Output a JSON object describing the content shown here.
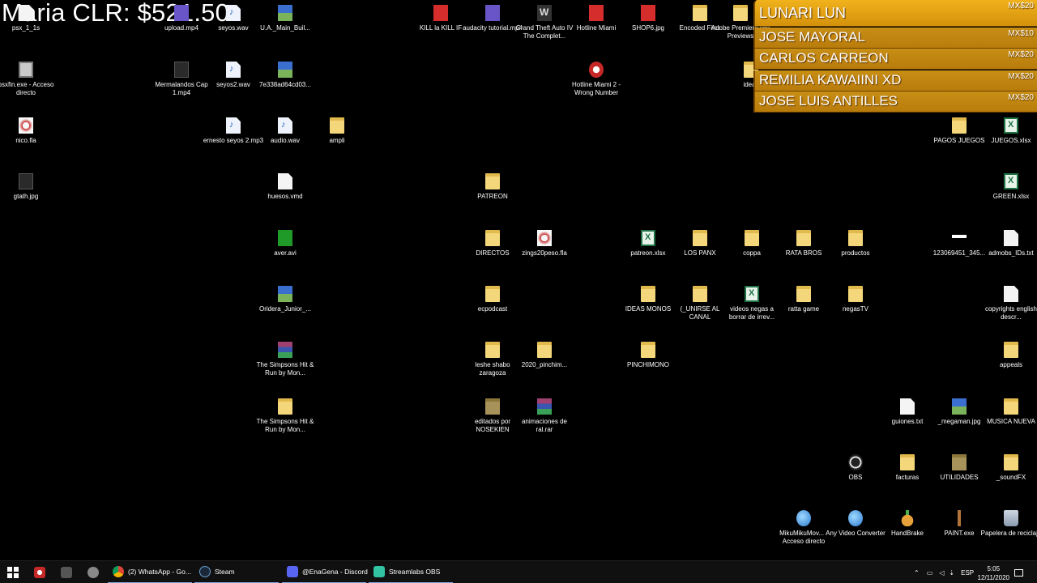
{
  "overlay": {
    "title": "Maria CLR: $521.50"
  },
  "leaderboard": [
    {
      "name": "LUNARI LUN",
      "amount": "MX$20"
    },
    {
      "name": "JOSE MAYORAL",
      "amount": "MX$10"
    },
    {
      "name": "CARLOS CARREON",
      "amount": "MX$20"
    },
    {
      "name": "REMILIA KAWAIINI XD",
      "amount": "MX$20"
    },
    {
      "name": "JOSE LUIS ANTILLES",
      "amount": "MX$20"
    }
  ],
  "desktop": {
    "icons": [
      {
        "label": "psx_1_1s",
        "icon": "file-icon"
      },
      {
        "label": "upload.mp4",
        "icon": "video-file-icon"
      },
      {
        "label": "seyos.wav",
        "icon": "audio-file-icon"
      },
      {
        "label": "U.A._Main_Buil...",
        "icon": "image-file-icon"
      },
      {
        "label": "KILL la KILL IF",
        "icon": "game-icon"
      },
      {
        "label": "audacity tutorial.mp4",
        "icon": "video-file-icon"
      },
      {
        "label": "Grand Theft Auto IV The Complet...",
        "icon": "game-icon"
      },
      {
        "label": "Hotline Miami",
        "icon": "game-icon"
      },
      {
        "label": "SHOP6.jpg",
        "icon": "image-file-icon"
      },
      {
        "label": "Encoded Files",
        "icon": "folder-icon"
      },
      {
        "label": "Adobe Premiere Pro Previews",
        "icon": "folder-icon"
      },
      {
        "label": "psxfin.exe - Acceso directo",
        "icon": "shortcut-icon"
      },
      {
        "label": "Mermalandos Cap 1.mp4",
        "icon": "video-file-icon"
      },
      {
        "label": "seyos2.wav",
        "icon": "audio-file-icon"
      },
      {
        "label": "7e338ad64cd03...",
        "icon": "image-file-icon"
      },
      {
        "label": "Hotline Miami 2 - Wrong Number",
        "icon": "game-icon"
      },
      {
        "label": "ideas",
        "icon": "folder-icon"
      },
      {
        "label": "nico.fla",
        "icon": "fla-file-icon"
      },
      {
        "label": "ernesto seyos 2.mp3",
        "icon": "audio-file-icon"
      },
      {
        "label": "audio.wav",
        "icon": "audio-file-icon"
      },
      {
        "label": "ampli",
        "icon": "folder-icon"
      },
      {
        "label": "PAGOS JUEGOS",
        "icon": "folder-icon"
      },
      {
        "label": "JUEGOS.xlsx",
        "icon": "excel-file-icon"
      },
      {
        "label": "gtath.jpg",
        "icon": "image-file-icon"
      },
      {
        "label": "huesos.vmd",
        "icon": "file-icon"
      },
      {
        "label": "PATREON",
        "icon": "folder-icon"
      },
      {
        "label": "GREEN.xlsx",
        "icon": "excel-file-icon"
      },
      {
        "label": "aver.avi",
        "icon": "video-file-icon"
      },
      {
        "label": "DIRECTOS",
        "icon": "folder-icon"
      },
      {
        "label": "zings20peso.fla",
        "icon": "fla-file-icon"
      },
      {
        "label": "patreon.xlsx",
        "icon": "excel-file-icon"
      },
      {
        "label": "LOS PANX",
        "icon": "folder-icon"
      },
      {
        "label": "coppa",
        "icon": "folder-icon"
      },
      {
        "label": "RATA BROS",
        "icon": "folder-icon"
      },
      {
        "label": "productos",
        "icon": "folder-icon"
      },
      {
        "label": "123069451_345...",
        "icon": "image-file-icon"
      },
      {
        "label": "admobs_IDs.txt",
        "icon": "text-file-icon"
      },
      {
        "label": "Oridera_Junior_...",
        "icon": "image-file-icon"
      },
      {
        "label": "ecpodcast",
        "icon": "folder-icon"
      },
      {
        "label": "IDEAS MONOS",
        "icon": "folder-icon"
      },
      {
        "label": "(_UNIRSE AL CANAL",
        "icon": "folder-icon"
      },
      {
        "label": "videos negas a borrar de irrev...",
        "icon": "excel-file-icon"
      },
      {
        "label": "ratta game",
        "icon": "folder-icon"
      },
      {
        "label": "negasTV",
        "icon": "folder-icon"
      },
      {
        "label": "copyrights english descr...",
        "icon": "text-file-icon"
      },
      {
        "label": "The Simpsons Hit & Run by Mon...",
        "icon": "archive-icon"
      },
      {
        "label": "leshe shabo zaragoza",
        "icon": "folder-icon"
      },
      {
        "label": "2020_pinchim...",
        "icon": "folder-icon"
      },
      {
        "label": "PINCHIMONO",
        "icon": "folder-icon"
      },
      {
        "label": "appeals",
        "icon": "folder-icon"
      },
      {
        "label": "The Simpsons Hit & Run by Mon...",
        "icon": "folder-icon"
      },
      {
        "label": "editados por NOSEKIEN",
        "icon": "folder-icon"
      },
      {
        "label": "animaciones de ral.rar",
        "icon": "archive-icon"
      },
      {
        "label": "guiones.txt",
        "icon": "text-file-icon"
      },
      {
        "label": "_megaman.jpg",
        "icon": "image-file-icon"
      },
      {
        "label": "MUSICA NUEVA",
        "icon": "folder-icon"
      },
      {
        "label": "OBS",
        "icon": "obs-icon"
      },
      {
        "label": "facturas",
        "icon": "folder-icon"
      },
      {
        "label": "UTILIDADES",
        "icon": "folder-icon"
      },
      {
        "label": "_soundFX",
        "icon": "folder-icon"
      },
      {
        "label": "MikuMikuMov... - Acceso directo",
        "icon": "shortcut-icon"
      },
      {
        "label": "Any Video Converter",
        "icon": "app-icon"
      },
      {
        "label": "HandBrake",
        "icon": "app-icon"
      },
      {
        "label": "PAINT.exe",
        "icon": "app-icon"
      },
      {
        "label": "Papelera de reciclaje",
        "icon": "recycle-bin-icon"
      }
    ]
  },
  "taskbar": {
    "apps": [
      {
        "label": "(2) WhatsApp - Go...",
        "icon": "chrome-icon"
      },
      {
        "label": "Steam",
        "icon": "steam-icon"
      },
      {
        "label": "@EnaGena - Discord",
        "icon": "discord-icon"
      },
      {
        "label": "Streamlabs OBS",
        "icon": "streamlabs-icon"
      }
    ],
    "language": "ESP",
    "time": "5:05",
    "date": "12/11/2020"
  },
  "colors": {
    "board_gold": "#d4920c",
    "desktop_bg": "#000000",
    "taskbar_bg": "#101010"
  }
}
